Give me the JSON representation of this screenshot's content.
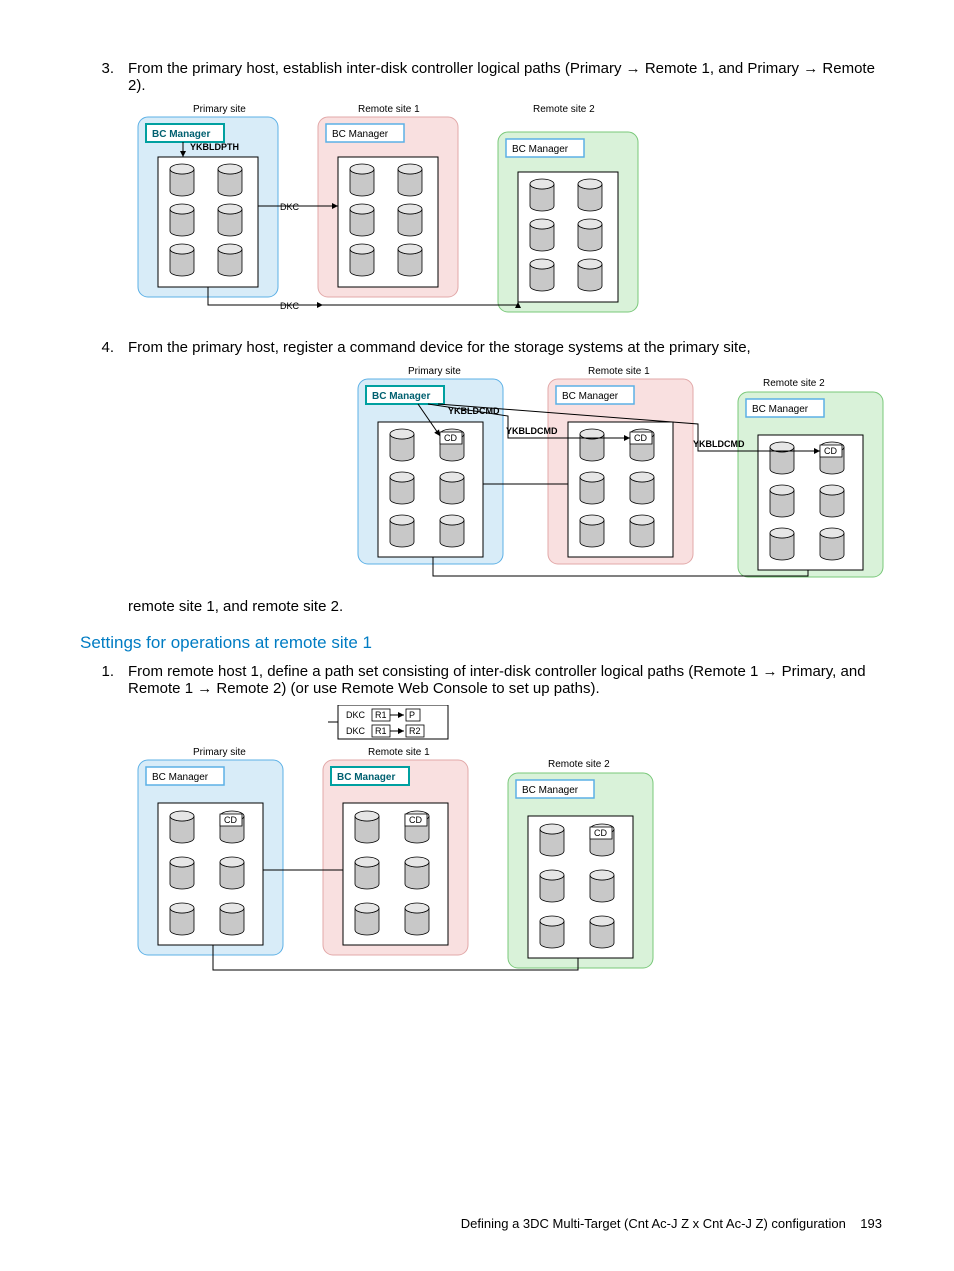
{
  "steps_a": {
    "3": {
      "num": "3.",
      "text_a": "From the primary host, establish inter-disk controller logical paths (Primary → Remote 1, and Primary → Remote 2)."
    },
    "4": {
      "num": "4.",
      "text_a": "From the primary host, register a command device for the storage systems at the primary site,",
      "text_b": "remote site 1, and remote site 2."
    }
  },
  "heading": "Settings for operations at remote site 1",
  "steps_b": {
    "1": {
      "num": "1.",
      "text": "From remote host 1, define a path set consisting of inter-disk controller logical paths (Remote 1 → Primary, and Remote 1 → Remote 2) (or use Remote Web Console to set up paths)."
    }
  },
  "labels": {
    "primary_site": "Primary site",
    "remote_site_1": "Remote site 1",
    "remote_site_2": "Remote site 2",
    "bc_manager": "BC Manager",
    "ykbldpth": "YKBLDPTH",
    "ykbldcmd": "YKBLDCMD",
    "dkc": "DKC",
    "cd": "CD",
    "r1": "R1",
    "r2": "R2",
    "p": "P"
  },
  "footer": {
    "text": "Defining a 3DC Multi-Target (Cnt Ac-J Z x Cnt Ac-J Z) configuration",
    "page": "193"
  }
}
